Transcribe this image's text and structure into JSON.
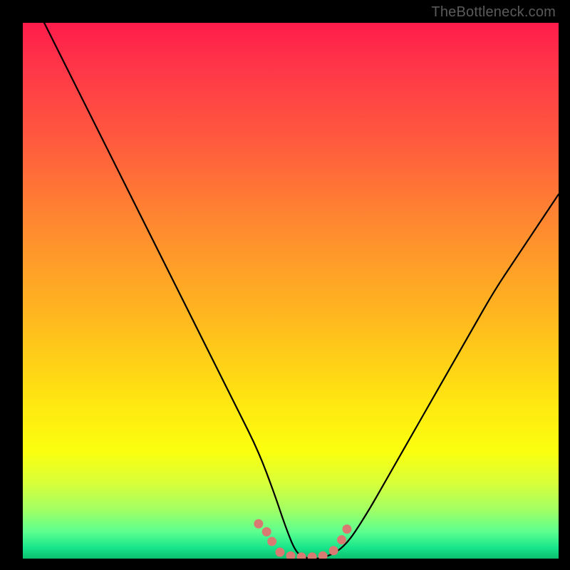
{
  "attribution": "TheBottleneck.com",
  "colors": {
    "frame": "#000000",
    "gradient_top": "#ff1c4b",
    "gradient_bottom": "#0bbf6e",
    "curve": "#000000",
    "marker": "#d87a72"
  },
  "chart_data": {
    "type": "line",
    "title": "",
    "xlabel": "",
    "ylabel": "",
    "xlim": [
      0,
      100
    ],
    "ylim": [
      0,
      100
    ],
    "grid": false,
    "legend": false,
    "series": [
      {
        "name": "bottleneck-curve",
        "x": [
          4,
          8,
          12,
          16,
          20,
          24,
          28,
          32,
          36,
          40,
          44,
          47,
          49,
          51,
          53,
          56,
          60,
          64,
          68,
          72,
          76,
          80,
          84,
          88,
          92,
          96,
          100
        ],
        "y": [
          100,
          92,
          84,
          76,
          68,
          60,
          52,
          44,
          36,
          28,
          20,
          12,
          6,
          1,
          0,
          0,
          2,
          8,
          15,
          22,
          29,
          36,
          43,
          50,
          56,
          62,
          68
        ]
      }
    ],
    "markers": [
      {
        "x": 44.0,
        "y": 6.5
      },
      {
        "x": 45.5,
        "y": 5.0
      },
      {
        "x": 46.5,
        "y": 3.2
      },
      {
        "x": 48.0,
        "y": 1.2
      },
      {
        "x": 50.0,
        "y": 0.5
      },
      {
        "x": 52.0,
        "y": 0.3
      },
      {
        "x": 54.0,
        "y": 0.3
      },
      {
        "x": 56.0,
        "y": 0.5
      },
      {
        "x": 58.0,
        "y": 1.5
      },
      {
        "x": 59.5,
        "y": 3.5
      },
      {
        "x": 60.5,
        "y": 5.5
      }
    ]
  }
}
